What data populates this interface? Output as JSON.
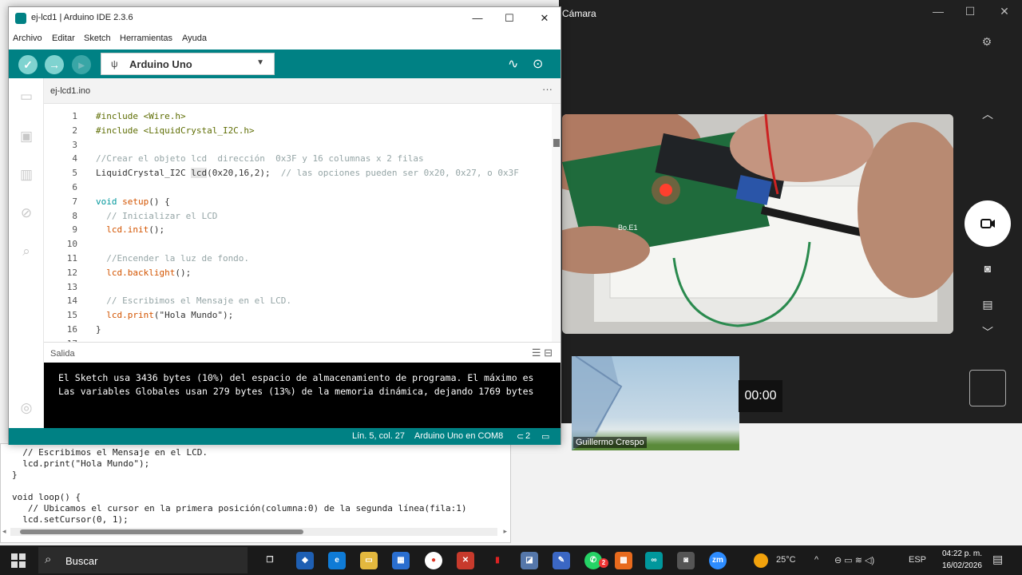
{
  "ide": {
    "title": "ej-lcd1 | Arduino IDE 2.3.6",
    "menu": [
      "Archivo",
      "Editar",
      "Sketch",
      "Herramientas",
      "Ayuda"
    ],
    "board": "Arduino Uno",
    "tab": "ej-lcd1.ino",
    "output_label": "Salida",
    "code_lines": [
      {
        "n": "1",
        "t": "#include <Wire.h>",
        "cls": "pp"
      },
      {
        "n": "2",
        "t": "#include <LiquidCrystal_I2C.h>",
        "cls": "pp"
      },
      {
        "n": "3",
        "t": "",
        "cls": ""
      },
      {
        "n": "4",
        "t": "//Crear el objeto lcd  dirección  0x3F y 16 columnas x 2 filas",
        "cls": "cm"
      },
      {
        "n": "5",
        "t": "LiquidCrystal_I2C lcd(0x20,16,2);  // las opciones pueden ser 0x20, 0x27, o 0x3F",
        "cls": "hl5"
      },
      {
        "n": "6",
        "t": "",
        "cls": ""
      },
      {
        "n": "7",
        "t": "void setup() {",
        "cls": "kw7"
      },
      {
        "n": "8",
        "t": "  // Inicializar el LCD",
        "cls": "cm"
      },
      {
        "n": "9",
        "t": "  lcd.init();",
        "cls": "fn"
      },
      {
        "n": "10",
        "t": "",
        "cls": ""
      },
      {
        "n": "11",
        "t": "  //Encender la luz de fondo.",
        "cls": "cm"
      },
      {
        "n": "12",
        "t": "  lcd.backlight();",
        "cls": "fn"
      },
      {
        "n": "13",
        "t": "",
        "cls": ""
      },
      {
        "n": "14",
        "t": "  // Escribimos el Mensaje en el LCD.",
        "cls": "cm"
      },
      {
        "n": "15",
        "t": "  lcd.print(\"Hola Mundo\");",
        "cls": "fn"
      },
      {
        "n": "16",
        "t": "}",
        "cls": ""
      },
      {
        "n": "17",
        "t": "",
        "cls": ""
      }
    ],
    "console": [
      "El Sketch usa 3436 bytes (10%) del espacio de almacenamiento de programa. El máximo es",
      "Las variables Globales usan 279 bytes (13%) de la memoria dinámica, dejando 1769 bytes"
    ],
    "status": {
      "position": "Lín. 5, col. 27",
      "board_port": "Arduino Uno en COM8",
      "notifications": "2"
    }
  },
  "background_code": [
    "  // Escribimos el Mensaje en el LCD.",
    "  lcd.print(\"Hola Mundo\");",
    "}",
    "",
    "void loop() {",
    "   // Ubicamos el cursor en la primera posición(columna:0) de la segunda línea(fila:1)",
    "  lcd.setCursor(0, 1);"
  ],
  "camera": {
    "title": "Cámara",
    "timer": "00:00",
    "participant": "Guillermo Crespo",
    "board_label": "Bo.E1"
  },
  "taskbar": {
    "search_placeholder": "Buscar",
    "temperature": "25°C",
    "language": "ESP",
    "time": "04:22 p. m.",
    "date": "16/02/2026",
    "whatsapp_badge": "2"
  },
  "colors": {
    "arduino_teal": "#008184",
    "console_bg": "#000000",
    "taskbar": "#1a1a1a"
  }
}
